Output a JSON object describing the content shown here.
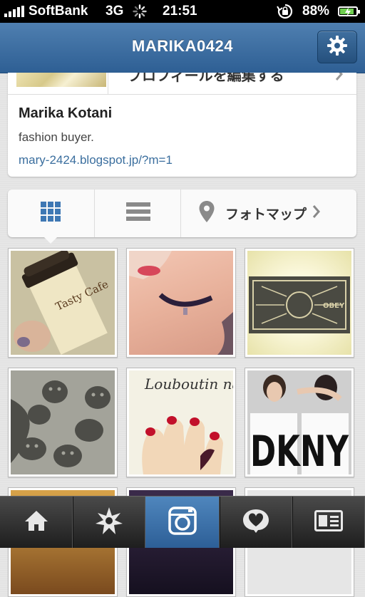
{
  "status_bar": {
    "carrier": "SoftBank",
    "network": "3G",
    "time": "21:51",
    "battery_percent": "88%",
    "signal_bars": 5,
    "battery_level": 0.88
  },
  "nav": {
    "title": "MARIKA0424",
    "settings_icon": "gear-icon"
  },
  "profile": {
    "edit_label": "プロフィールを編集する",
    "name": "Marika Kotani",
    "bio": "fashion buyer.",
    "website": "mary-2424.blogspot.jp/?m=1"
  },
  "view_toggle": {
    "grid_icon": "grid-icon",
    "list_icon": "list-icon",
    "map_icon": "map-pin-icon",
    "map_label": "フォトマップ",
    "selected": "grid"
  },
  "photos": [
    {
      "caption_text": "Tasty Cafe"
    },
    {
      "caption_text": ""
    },
    {
      "caption_text": "OBEY"
    },
    {
      "caption_text": ""
    },
    {
      "caption_text": "Louboutin nails"
    },
    {
      "caption_text": "DKNY"
    },
    {
      "caption_text": ""
    },
    {
      "caption_text": ""
    },
    {
      "caption_text": ""
    }
  ],
  "tabbar": {
    "tabs": [
      {
        "icon": "home-icon"
      },
      {
        "icon": "explore-star-icon"
      },
      {
        "icon": "camera-icon",
        "selected": true
      },
      {
        "icon": "activity-heart-icon"
      },
      {
        "icon": "profile-card-icon"
      }
    ]
  },
  "colors": {
    "nav_blue": "#3b6ea3",
    "link_blue": "#3a6e9e",
    "accent_selected": "#4f86bd",
    "battery_green": "#6fcf4f"
  }
}
